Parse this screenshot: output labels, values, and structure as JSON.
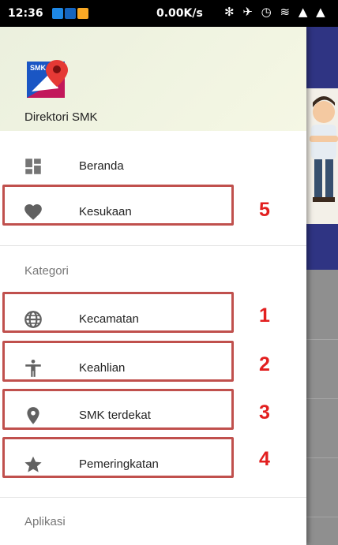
{
  "status_bar": {
    "time": "12:36",
    "network_speed": "0.00K/s",
    "status_icons": "✻ ✈ ◷ ≋ ▲ ▲"
  },
  "drawer": {
    "app_name": "Direktori SMK",
    "logo_text": "SMK",
    "items_top": [
      {
        "label": "Beranda",
        "icon": "dashboard-icon"
      },
      {
        "label": "Kesukaan",
        "icon": "heart-icon"
      }
    ],
    "section_category": "Kategori",
    "items_category": [
      {
        "label": "Kecamatan",
        "icon": "globe-icon"
      },
      {
        "label": "Keahlian",
        "icon": "accessibility-icon"
      },
      {
        "label": "SMK terdekat",
        "icon": "location-pin-icon"
      },
      {
        "label": "Pemeringkatan",
        "icon": "star-icon"
      }
    ],
    "section_app": "Aplikasi"
  },
  "annotations": [
    "5",
    "1",
    "2",
    "3",
    "4"
  ],
  "colors": {
    "toolbar": "#2f3483",
    "highlight_box": "#c0504d",
    "annotation_number": "#e21f1f",
    "header_bg": "#eef2df"
  }
}
